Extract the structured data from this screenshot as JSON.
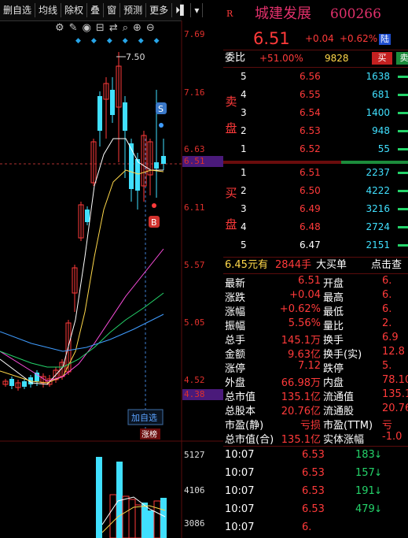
{
  "toolbar": {
    "items": [
      "删自选",
      "均线",
      "除权",
      "叠",
      "窗",
      "预测",
      "更多",
      "⏵▌",
      "▾"
    ]
  },
  "price_axis": {
    "labels": [
      "7.69",
      "7.16",
      "6.63",
      "6.51",
      "6.11",
      "5.57",
      "5.05",
      "4.52",
      "4.38"
    ],
    "high_mark": "7.50"
  },
  "volume_axis": {
    "labels": [
      "5127",
      "4106",
      "3086"
    ]
  },
  "chart_overlays": {
    "add_watch": "加自选",
    "limit_up": "涨榜",
    "sell_marker": "S",
    "buy_marker": "B"
  },
  "colors": {
    "up": "#ff3a3a",
    "down": "#40e0ff",
    "bg": "#000000",
    "axis": "#e0302c",
    "ma5": "#ffffff",
    "ma10": "#ffd84a",
    "ma20": "#ff4fe0",
    "ma30": "#24d36a",
    "ma60": "#3f9cff"
  },
  "quote": {
    "badge": "R",
    "name": "城建发展",
    "code": "600266",
    "price": "6.51",
    "change": "+0.04",
    "change_pct": "+0.62%",
    "exchange": "陆"
  },
  "ratio": {
    "label": "委比",
    "value": "+51.00%",
    "diff": "9828",
    "buy_btn": "买",
    "sell_btn": "卖"
  },
  "sell_side": {
    "label": [
      "卖",
      "盘"
    ],
    "rows": [
      {
        "level": "5",
        "price": "6.56",
        "vol": "1638"
      },
      {
        "level": "4",
        "price": "6.55",
        "vol": "681"
      },
      {
        "level": "3",
        "price": "6.54",
        "vol": "1400"
      },
      {
        "level": "2",
        "price": "6.53",
        "vol": "948"
      },
      {
        "level": "1",
        "price": "6.52",
        "vol": "55"
      }
    ]
  },
  "buy_side": {
    "label": [
      "买",
      "盘"
    ],
    "rows": [
      {
        "level": "1",
        "price": "6.51",
        "vol": "2237"
      },
      {
        "level": "2",
        "price": "6.50",
        "vol": "4222"
      },
      {
        "level": "3",
        "price": "6.49",
        "vol": "3216"
      },
      {
        "level": "4",
        "price": "6.48",
        "vol": "2724"
      },
      {
        "level": "5",
        "price": "6.47",
        "vol": "2151"
      }
    ]
  },
  "big_order": {
    "price": "6.45元有",
    "qty": "2844手",
    "type": "大买单",
    "link": "点击查"
  },
  "stats": [
    {
      "l1": "最新",
      "v1": "6.51",
      "l2": "开盘",
      "v2": "6."
    },
    {
      "l1": "涨跌",
      "v1": "+0.04",
      "l2": "最高",
      "v2": "6."
    },
    {
      "l1": "涨幅",
      "v1": "+0.62%",
      "l2": "最低",
      "v2": "6."
    },
    {
      "l1": "振幅",
      "v1": "5.56%",
      "l2": "量比",
      "v2": "2."
    },
    {
      "l1": "总手",
      "v1": "145.1万",
      "l2": "换手",
      "v2": "6.9"
    },
    {
      "l1": "金额",
      "v1": "9.63亿",
      "l2": "换手(实)",
      "v2": "12.8"
    },
    {
      "l1": "涨停",
      "v1": "7.12",
      "l2": "跌停",
      "v2": "5."
    },
    {
      "l1": "外盘",
      "v1": "66.98万",
      "l2": "内盘",
      "v2": "78.10"
    },
    {
      "l1": "总市值",
      "v1": "135.1亿",
      "l2": "流通值",
      "v2": "135.1"
    },
    {
      "l1": "总股本",
      "v1": "20.76亿",
      "l2": "流通股",
      "v2": "20.76"
    },
    {
      "l1": "市盈(静)",
      "v1": "亏损",
      "l2": "市盈(TTM)",
      "v2": "亏"
    },
    {
      "l1": "总市值(合)",
      "v1": "135.1亿",
      "l2": "实体涨幅",
      "v2": "-1.0"
    }
  ],
  "ticks": [
    {
      "time": "10:07",
      "price": "6.53",
      "vol": "183"
    },
    {
      "time": "10:07",
      "price": "6.53",
      "vol": "157"
    },
    {
      "time": "10:07",
      "price": "6.53",
      "vol": "191"
    },
    {
      "time": "10:07",
      "price": "6.53",
      "vol": "479"
    },
    {
      "time": "10:07",
      "price": "6.",
      "vol": ""
    }
  ]
}
